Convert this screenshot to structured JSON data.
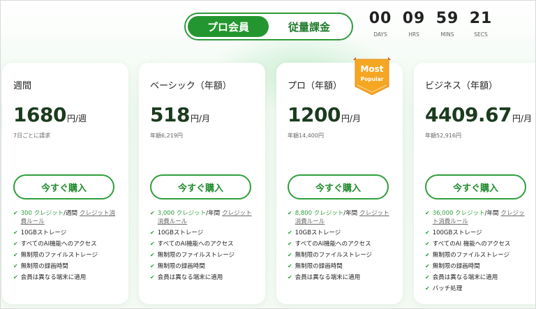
{
  "toggle": {
    "options": [
      "プロ会員",
      "従量課金"
    ],
    "active": 0
  },
  "countdown": [
    {
      "value": "00",
      "label": "DAYS"
    },
    {
      "value": "09",
      "label": "HRS"
    },
    {
      "value": "59",
      "label": "MINS"
    },
    {
      "value": "21",
      "label": "SECS"
    }
  ],
  "badge": {
    "line1": "Most",
    "line2": "Popular"
  },
  "buy_label": "今すぐ購入",
  "plans": [
    {
      "name": "週間",
      "price": "1680",
      "unit": "円/週",
      "sub": "7日ごとに請求",
      "features": [
        {
          "hl": "300 クレジット",
          "text": "/週間",
          "link": "クレジット消費ルール"
        },
        {
          "text": "10GBストレージ"
        },
        {
          "text": "すべてのAI機能へのアクセス"
        },
        {
          "text": "無制限のファイルストレージ"
        },
        {
          "text": "無制限の録画時間"
        },
        {
          "text": "会員は異なる端末に適用"
        }
      ]
    },
    {
      "name": "ベーシック（年額）",
      "price": "518",
      "unit": "円/月",
      "sub": "年額6,219円",
      "features": [
        {
          "hl": "3,000 クレジット",
          "text": "/年間",
          "link": "クレジット消費ルール"
        },
        {
          "text": "10GBストレージ"
        },
        {
          "text": "すべてのAI機能へのアクセス"
        },
        {
          "text": "無制限のファイルストレージ"
        },
        {
          "text": "無制限の録画時間"
        },
        {
          "text": "会員は異なる端末に適用"
        }
      ]
    },
    {
      "name": "プロ（年額）",
      "price": "1200",
      "unit": "円/月",
      "sub": "年額14,400円",
      "features": [
        {
          "hl": "8,800 クレジット",
          "text": "/年間",
          "link": "クレジット消費ルール"
        },
        {
          "text": "10GBストレージ"
        },
        {
          "text": "すべてのAI機能へのアクセス"
        },
        {
          "text": "無制限のファイルストレージ"
        },
        {
          "text": "無制限の録画時間"
        },
        {
          "text": "会員は異なる端末に適用"
        }
      ]
    },
    {
      "name": "ビジネス（年額）",
      "price": "4409.67",
      "unit": "円/月",
      "sub": "年額52,916円",
      "features": [
        {
          "hl": "36,000 クレジット",
          "text": "/年間",
          "link": "クレジット消費ルール"
        },
        {
          "text": "100GBストレージ"
        },
        {
          "text": "すべてのAI 機能へのアクセス"
        },
        {
          "text": "無制限のファイルストレージ"
        },
        {
          "text": "無制限の録画時間"
        },
        {
          "text": "会員は異なる端末に適用"
        },
        {
          "text": "バッチ処理"
        }
      ]
    }
  ],
  "colors": {
    "accent": "#24962f",
    "badge": "#f5a623",
    "text_dark": "#1b3b1e"
  }
}
